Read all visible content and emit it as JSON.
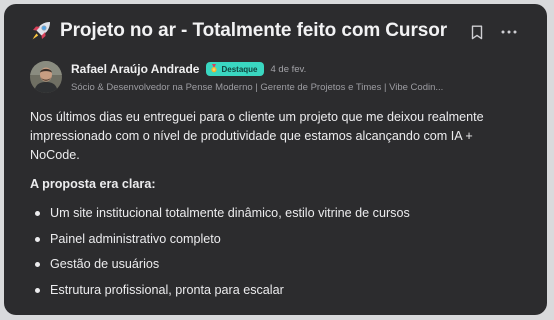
{
  "post": {
    "title": "Projeto no ar - Totalmente feito com Cursor",
    "title_icon": "rocket-emoji",
    "actions": {
      "bookmark_icon": "bookmark-icon",
      "more_icon": "more-options-icon"
    }
  },
  "author": {
    "name": "Rafael Araújo Andrade",
    "badge": "Destaque",
    "badge_icon": "medal-icon",
    "date": "4 de fev.",
    "headline": "Sócio & Desenvolvedor na Pense Moderno | Gerente de Projetos e Times | Vibe Codin..."
  },
  "body": {
    "intro": "Nos últimos dias eu entreguei para o cliente um projeto que me deixou realmente impressionado com o nível de produtividade que estamos alcançando com IA + NoCode.",
    "proposal_heading": "A proposta era clara:",
    "items": [
      "Um site institucional totalmente dinâmico, estilo vitrine de cursos",
      "Painel administrativo completo",
      "Gestão de usuários",
      "Estrutura profissional, pronta para escalar"
    ]
  },
  "colors": {
    "card_background": "#2c2c2e",
    "page_background": "#d9dadc",
    "badge_background": "#3ad7c1",
    "text_primary": "#ececee",
    "text_muted": "#9d9da2"
  }
}
